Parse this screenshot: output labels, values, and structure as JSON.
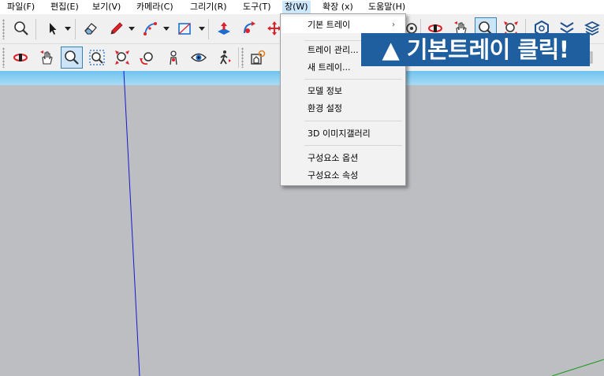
{
  "menubar": {
    "items": [
      {
        "label": "파일(F)"
      },
      {
        "label": "편집(E)"
      },
      {
        "label": "보기(V)"
      },
      {
        "label": "카메라(C)"
      },
      {
        "label": "그리기(R)"
      },
      {
        "label": "도구(T)"
      },
      {
        "label": "창(W)"
      },
      {
        "label": "확장 (x)"
      },
      {
        "label": "도움말(H)"
      }
    ]
  },
  "window_menu": {
    "items": [
      {
        "label": "기본 트레이",
        "submenu_arrow": "›"
      },
      {
        "label": "트레이 관리..."
      },
      {
        "label": "새 트레이..."
      },
      {
        "label": "모델 정보"
      },
      {
        "label": "환경 설정"
      },
      {
        "label": "3D 이미지갤러리"
      },
      {
        "label": "구성요소 옵션"
      },
      {
        "label": "구성요소 속성"
      }
    ]
  },
  "callout": {
    "text": "▲ 기본트레이 클릭!"
  },
  "colors": {
    "menu_hover": "#cce8ff",
    "active_tool": "#cce4f7",
    "callout_bg": "#1f5f9f",
    "sky": "#8fd2f3",
    "ground": "#bdbec2",
    "axis_blue": "#1818c8",
    "axis_green": "#1a9a1a",
    "icon_red": "#e0202a",
    "icon_blue": "#1d6fcf"
  },
  "toolbar1": {
    "tools": [
      "search-icon",
      "select-arrow-icon",
      "eraser-icon",
      "pencil-line-icon",
      "arc-icon",
      "rectangle-icon",
      "push-pull-icon",
      "follow-me-icon",
      "move-icon"
    ]
  },
  "toolbar2": {
    "tools": [
      "orbit-icon",
      "pan-icon",
      "zoom-icon",
      "zoom-window-icon",
      "zoom-extents-icon",
      "previous-view-icon",
      "position-camera-icon",
      "look-around-icon",
      "walk-icon",
      "section-icon"
    ]
  }
}
